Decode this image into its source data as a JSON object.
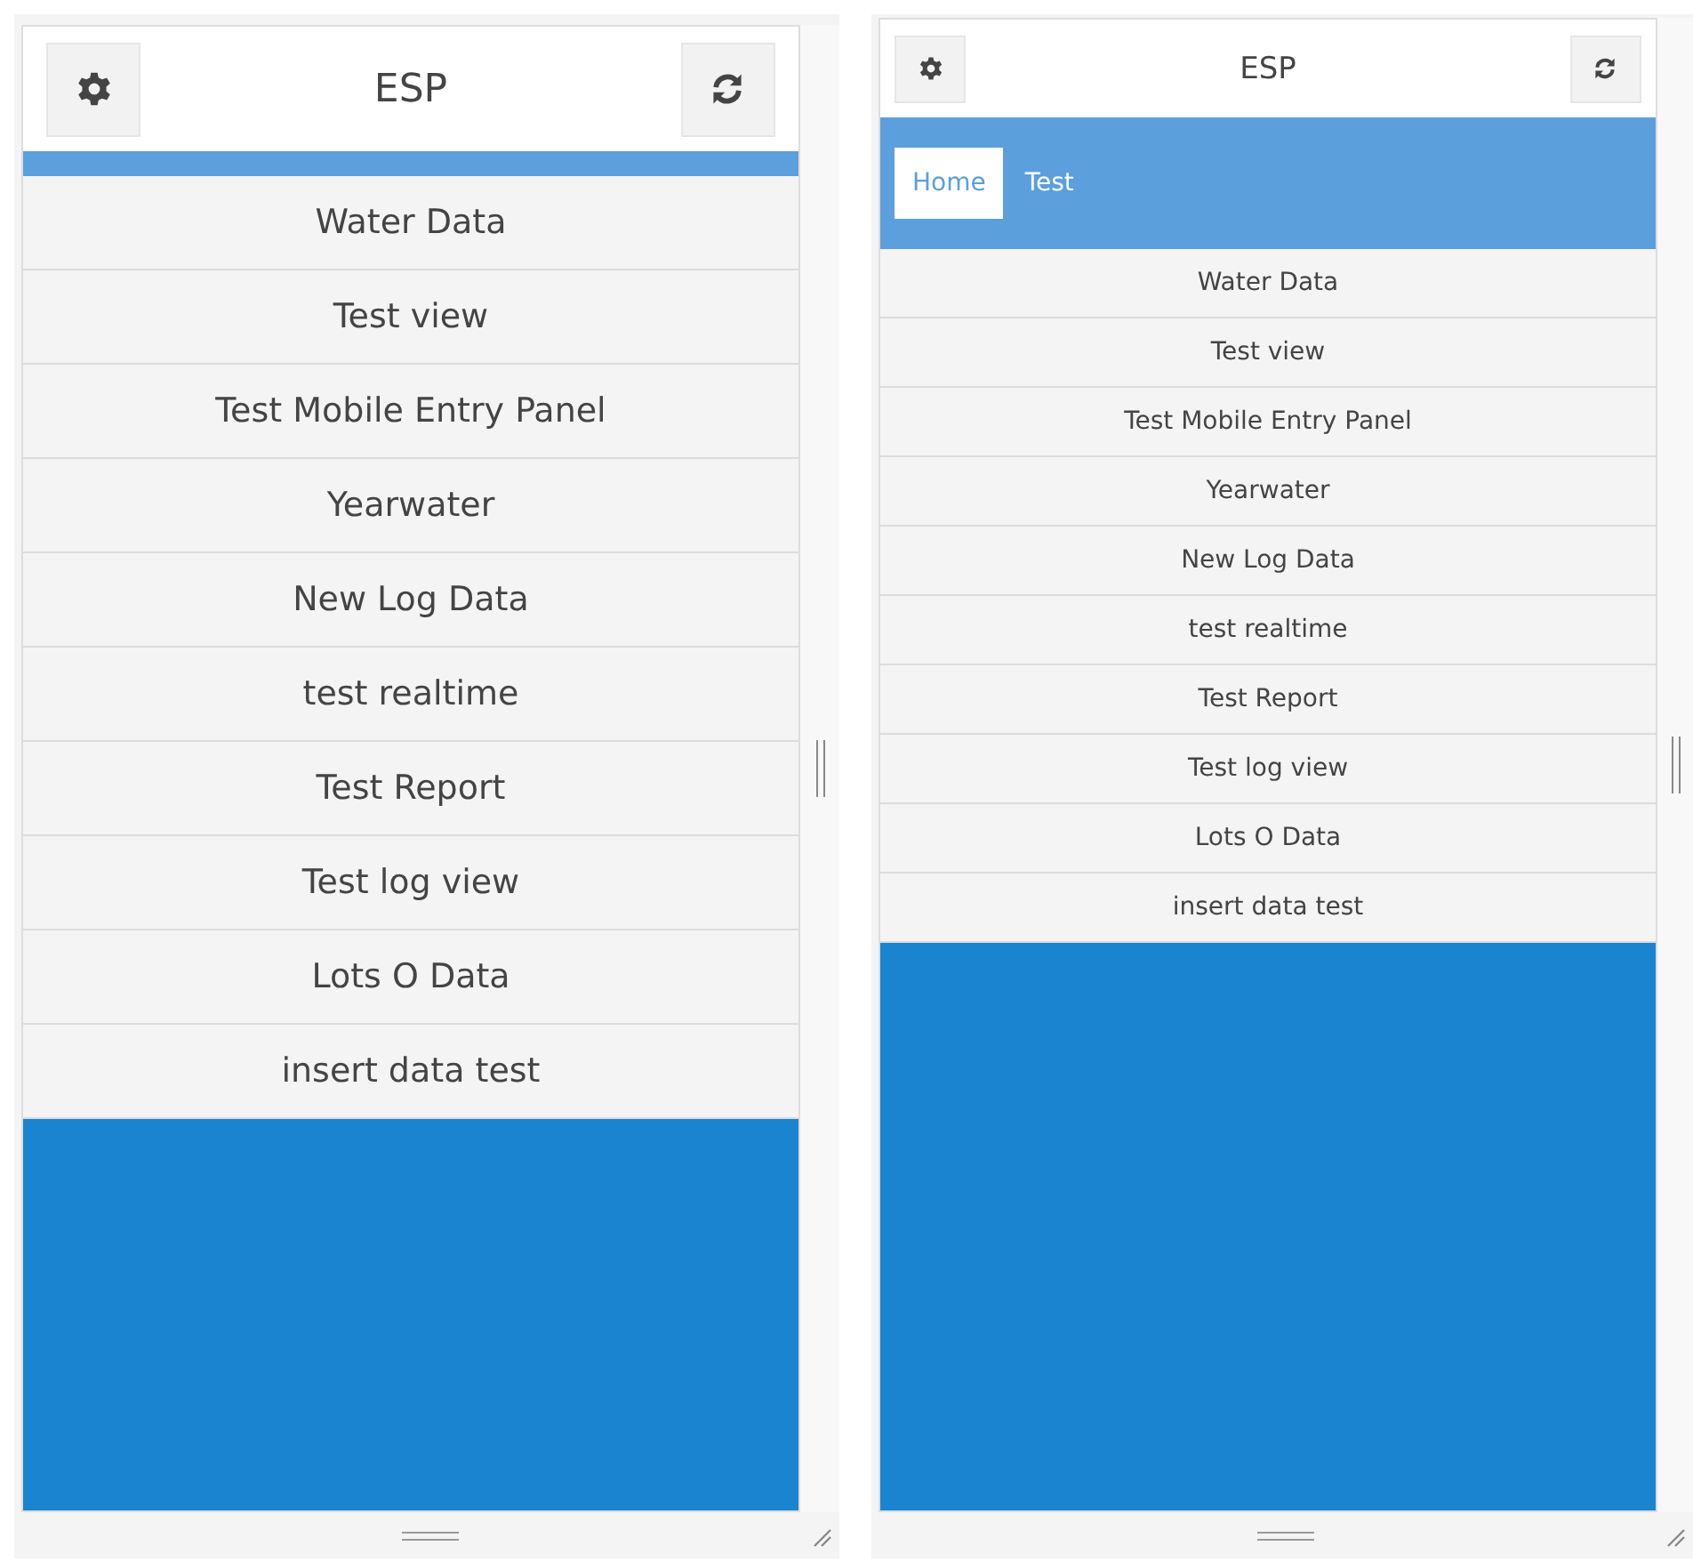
{
  "previews": [
    {
      "kind": "large",
      "title": "ESP",
      "items": [
        "Water Data",
        "Test view",
        "Test Mobile Entry Panel",
        "Yearwater",
        "New Log Data",
        "test realtime",
        "Test Report",
        "Test log view",
        "Lots O Data",
        "insert data test"
      ]
    },
    {
      "kind": "small",
      "title": "ESP",
      "tabs": [
        {
          "label": "Home",
          "selected": true
        },
        {
          "label": "Test",
          "selected": false
        }
      ],
      "items": [
        "Water Data",
        "Test view",
        "Test Mobile Entry Panel",
        "Yearwater",
        "New Log Data",
        "test realtime",
        "Test Report",
        "Test log view",
        "Lots O Data",
        "insert data test"
      ]
    }
  ]
}
